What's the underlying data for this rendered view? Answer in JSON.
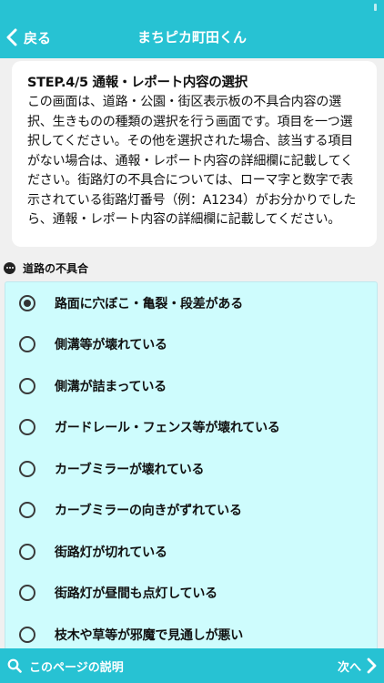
{
  "navbar": {
    "back_label": "戻る",
    "title": "まちピカ町田くん"
  },
  "info": {
    "step_title": "STEP.4/5 通報・レポート内容の選択",
    "description": "この画面は、道路・公園・街区表示板の不具合内容の選択、生きものの種類の選択を行う画面です。項目を一つ選択してください。その他を選択された場合、該当する項目がない場合は、通報・レポート内容の詳細欄に記載してください。街路灯の不具合については、ローマ字と数字で表示されている街路灯番号（例：A1234）がお分かりでしたら、通報・レポート内容の詳細欄に記載してください。"
  },
  "section": {
    "title": "道路の不具合"
  },
  "options": [
    {
      "label": "路面に穴ぼこ・亀裂・段差がある",
      "selected": true
    },
    {
      "label": "側溝等が壊れている",
      "selected": false
    },
    {
      "label": "側溝が詰まっている",
      "selected": false
    },
    {
      "label": "ガードレール・フェンス等が壊れている",
      "selected": false
    },
    {
      "label": "カーブミラーが壊れている",
      "selected": false
    },
    {
      "label": "カーブミラーの向きがずれている",
      "selected": false
    },
    {
      "label": "街路灯が切れている",
      "selected": false
    },
    {
      "label": "街路灯が昼間も点灯している",
      "selected": false
    },
    {
      "label": "枝木や草等が邪魔で見通しが悪い",
      "selected": false
    }
  ],
  "bottom": {
    "help_label": "このページの説明",
    "next_label": "次へ"
  },
  "colors": {
    "accent": "#27c2d3",
    "list_background": "#cefcfd"
  },
  "icons": [
    "chevron-left-icon",
    "dots-icon",
    "search-icon",
    "chevron-right-icon"
  ]
}
